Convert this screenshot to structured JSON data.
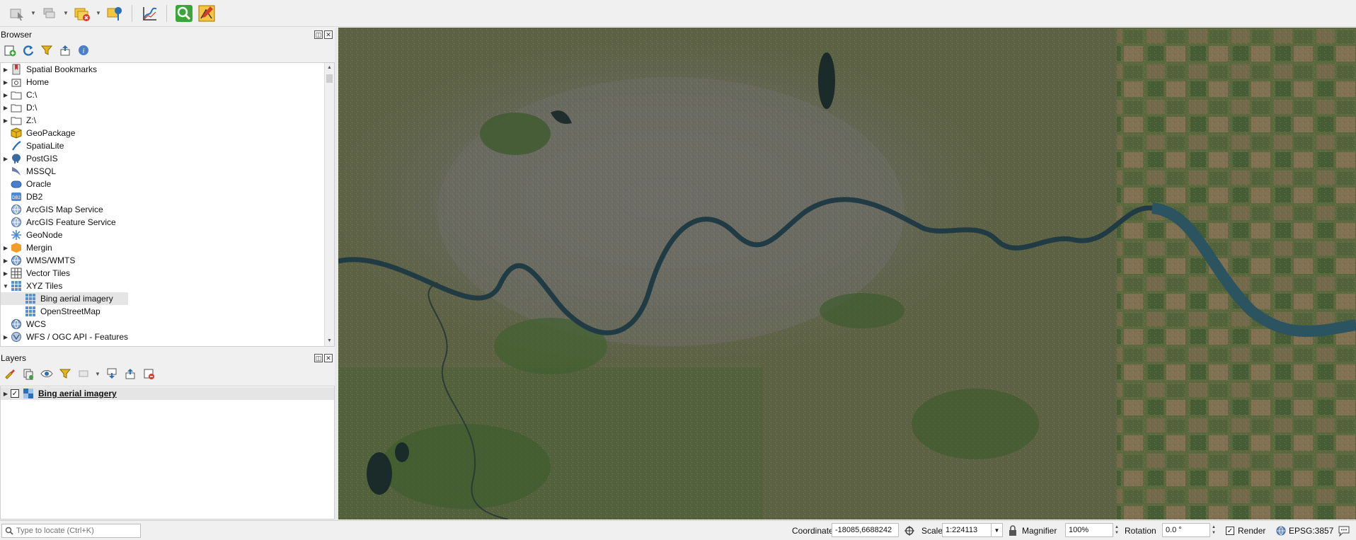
{
  "toolbar": {
    "buttons": [
      {
        "name": "select-features-icon"
      },
      {
        "name": "deselect-features-icon"
      },
      {
        "name": "remove-layer-icon"
      },
      {
        "name": "identify-point-icon"
      },
      {
        "name": "profile-tool-icon"
      },
      {
        "name": "locator-search-icon"
      },
      {
        "name": "digitize-tool-icon"
      }
    ]
  },
  "browser": {
    "title": "Browser",
    "items": [
      {
        "label": "Spatial Bookmarks",
        "expandable": true,
        "icon": "bookmark-icon"
      },
      {
        "label": "Home",
        "expandable": true,
        "icon": "home-folder-icon"
      },
      {
        "label": "C:\\",
        "expandable": true,
        "icon": "folder-icon"
      },
      {
        "label": "D:\\",
        "expandable": true,
        "icon": "folder-icon"
      },
      {
        "label": "Z:\\",
        "expandable": true,
        "icon": "folder-icon"
      },
      {
        "label": "GeoPackage",
        "expandable": false,
        "icon": "geopackage-icon"
      },
      {
        "label": "SpatiaLite",
        "expandable": false,
        "icon": "spatialite-icon"
      },
      {
        "label": "PostGIS",
        "expandable": true,
        "icon": "postgis-icon"
      },
      {
        "label": "MSSQL",
        "expandable": false,
        "icon": "mssql-icon"
      },
      {
        "label": "Oracle",
        "expandable": false,
        "icon": "oracle-icon"
      },
      {
        "label": "DB2",
        "expandable": false,
        "icon": "db2-icon"
      },
      {
        "label": "ArcGIS Map Service",
        "expandable": false,
        "icon": "arcgis-map-icon"
      },
      {
        "label": "ArcGIS Feature Service",
        "expandable": false,
        "icon": "arcgis-feature-icon"
      },
      {
        "label": "GeoNode",
        "expandable": false,
        "icon": "geonode-icon"
      },
      {
        "label": "Mergin",
        "expandable": true,
        "icon": "mergin-icon"
      },
      {
        "label": "WMS/WMTS",
        "expandable": true,
        "icon": "wms-icon"
      },
      {
        "label": "Vector Tiles",
        "expandable": true,
        "icon": "vector-tiles-icon"
      },
      {
        "label": "XYZ Tiles",
        "expanded": true,
        "icon": "xyz-tiles-icon"
      },
      {
        "label": "Bing aerial imagery",
        "child": true,
        "selected": true,
        "icon": "xyz-layer-icon"
      },
      {
        "label": "OpenStreetMap",
        "child": true,
        "icon": "xyz-layer-icon"
      },
      {
        "label": "WCS",
        "expandable": false,
        "icon": "wcs-icon"
      },
      {
        "label": "WFS / OGC API - Features",
        "expandable": true,
        "icon": "wfs-icon"
      }
    ]
  },
  "layers": {
    "title": "Layers",
    "items": [
      {
        "label": "Bing aerial imagery",
        "checked": true,
        "icon": "raster-layer-icon"
      }
    ]
  },
  "statusbar": {
    "locator_placeholder": "Type to locate (Ctrl+K)",
    "coordinate_label": "Coordinate",
    "coordinate_value": "-18085,6688242",
    "scale_label": "Scale",
    "scale_value": "1:224113",
    "magnifier_label": "Magnifier",
    "magnifier_value": "100%",
    "rotation_label": "Rotation",
    "rotation_value": "0.0 °",
    "render_label": "Render",
    "render_checked": true,
    "crs_label": "EPSG:3857"
  },
  "colors": {
    "river": "#1f3a42",
    "urban": "#6b6b62",
    "rural": "#5a6a3e",
    "field_brown": "#7d6a4c"
  }
}
